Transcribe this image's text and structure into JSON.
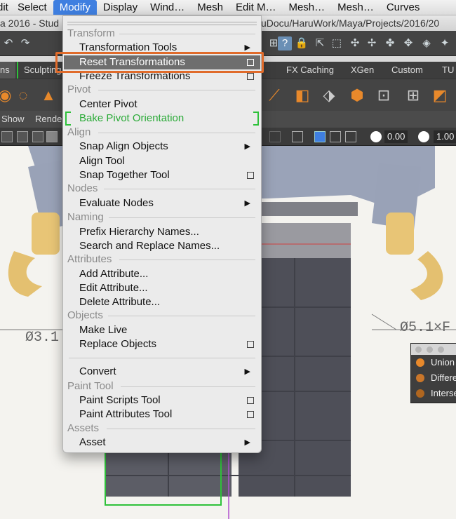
{
  "menubar": {
    "items": [
      {
        "label": "Edit"
      },
      {
        "label": "Select"
      },
      {
        "label": "Modify"
      },
      {
        "label": "Display"
      },
      {
        "label": "Wind…"
      },
      {
        "label": "Mesh"
      },
      {
        "label": "Edit M…"
      },
      {
        "label": "Mesh…"
      },
      {
        "label": "Mesh…"
      },
      {
        "label": "Curves"
      }
    ],
    "active": "Modify"
  },
  "titlebar": {
    "left": "a 2016 - Stud",
    "right": "uDocu/HaruWork/Maya/Projects/2016/20"
  },
  "shelf_tabs": [
    "ns",
    "Sculpting",
    "FX Caching",
    "XGen",
    "Custom",
    "TU"
  ],
  "panel_menu": [
    "Show",
    "Rende"
  ],
  "panel_toolbar": {
    "field1": "0.00",
    "field2": "1.00"
  },
  "viewport": {
    "dim_left": "Ø3.1",
    "dim_right": "Ø5.1×F"
  },
  "bool_panel": {
    "items": [
      "Union",
      "Differe",
      "Interse"
    ]
  },
  "dropdown": {
    "sections": [
      {
        "title": "Transform",
        "items": [
          {
            "label": "Transformation Tools",
            "kind": "submenu"
          },
          {
            "label": "Reset Transformations",
            "kind": "option",
            "highlighted": true
          },
          {
            "label": "Freeze Transformations",
            "kind": "option"
          }
        ]
      },
      {
        "title": "Pivot",
        "items": [
          {
            "label": "Center Pivot",
            "kind": "plain"
          },
          {
            "label": "Bake Pivot Orientation",
            "kind": "green"
          }
        ]
      },
      {
        "title": "Align",
        "items": [
          {
            "label": "Snap Align Objects",
            "kind": "submenu"
          },
          {
            "label": "Align Tool",
            "kind": "plain"
          },
          {
            "label": "Snap Together Tool",
            "kind": "option"
          }
        ]
      },
      {
        "title": "Nodes",
        "items": [
          {
            "label": "Evaluate Nodes",
            "kind": "submenu"
          }
        ]
      },
      {
        "title": "Naming",
        "items": [
          {
            "label": "Prefix Hierarchy Names...",
            "kind": "plain"
          },
          {
            "label": "Search and Replace Names...",
            "kind": "plain"
          }
        ]
      },
      {
        "title": "Attributes",
        "items": [
          {
            "label": "Add Attribute...",
            "kind": "plain"
          },
          {
            "label": "Edit Attribute...",
            "kind": "plain"
          },
          {
            "label": "Delete Attribute...",
            "kind": "plain"
          }
        ]
      },
      {
        "title": "Objects",
        "items": [
          {
            "label": "Make Live",
            "kind": "plain"
          },
          {
            "label": "Replace Objects",
            "kind": "option"
          }
        ]
      },
      {
        "title": "",
        "items": [
          {
            "label": "Convert",
            "kind": "submenu"
          }
        ]
      },
      {
        "title": "Paint Tool",
        "items": [
          {
            "label": "Paint Scripts Tool",
            "kind": "option"
          },
          {
            "label": "Paint Attributes Tool",
            "kind": "option"
          }
        ]
      },
      {
        "title": "Assets",
        "items": [
          {
            "label": "Asset",
            "kind": "submenu"
          }
        ]
      }
    ]
  },
  "colors": {
    "highlight_border": "#e06b2b",
    "menu_highlight": "#6e6e6e",
    "green": "#2cab39",
    "shelf_orange": "#e8892b"
  }
}
